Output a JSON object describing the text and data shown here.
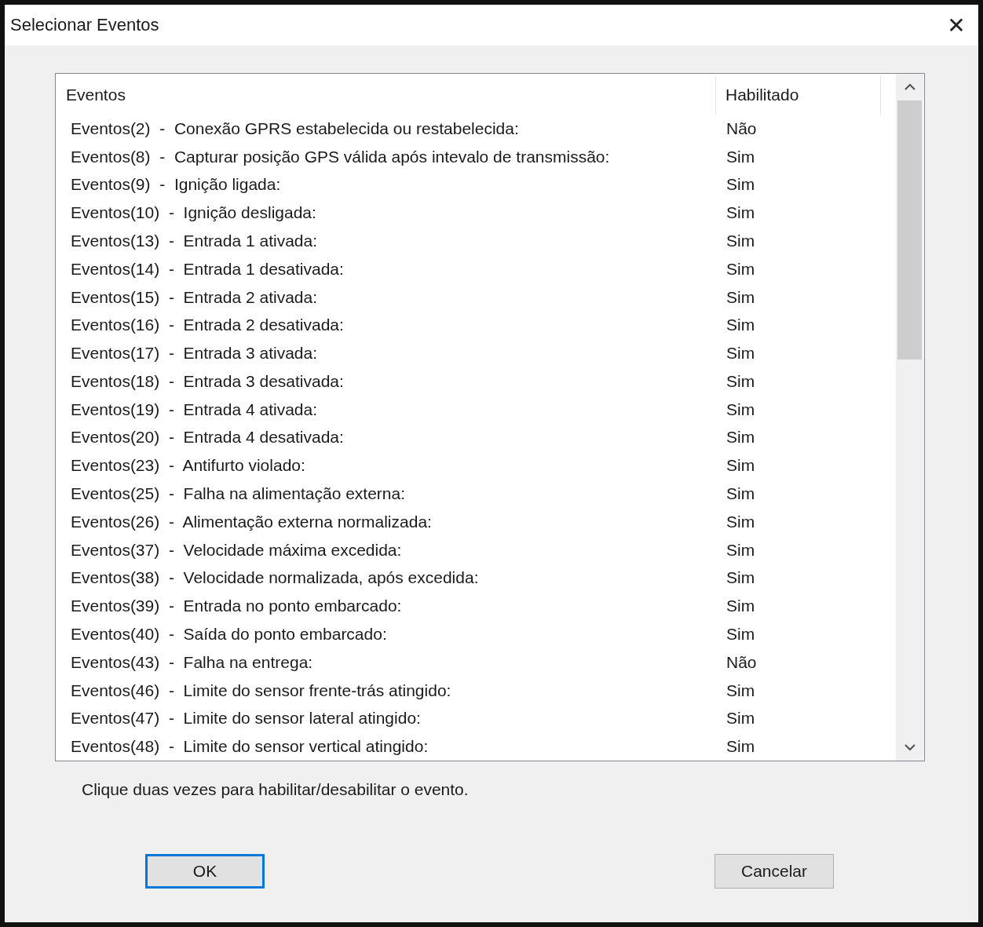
{
  "window": {
    "title": "Selecionar Eventos",
    "close": "✕"
  },
  "table": {
    "columns": [
      "Eventos",
      "Habilitado"
    ],
    "rows": [
      {
        "event": "Eventos(2)  -  Conexão GPRS estabelecida ou restabelecida:",
        "enabled": "Não"
      },
      {
        "event": "Eventos(8)  -  Capturar posição GPS válida após intevalo de transmissão:",
        "enabled": "Sim"
      },
      {
        "event": "Eventos(9)  -  Ignição ligada:",
        "enabled": "Sim"
      },
      {
        "event": "Eventos(10)  -  Ignição desligada:",
        "enabled": "Sim"
      },
      {
        "event": "Eventos(13)  -  Entrada 1 ativada:",
        "enabled": "Sim"
      },
      {
        "event": "Eventos(14)  -  Entrada 1 desativada:",
        "enabled": "Sim"
      },
      {
        "event": "Eventos(15)  -  Entrada 2 ativada:",
        "enabled": "Sim"
      },
      {
        "event": "Eventos(16)  -  Entrada 2 desativada:",
        "enabled": "Sim"
      },
      {
        "event": "Eventos(17)  -  Entrada 3 ativada:",
        "enabled": "Sim"
      },
      {
        "event": "Eventos(18)  -  Entrada 3 desativada:",
        "enabled": "Sim"
      },
      {
        "event": "Eventos(19)  -  Entrada 4 ativada:",
        "enabled": "Sim"
      },
      {
        "event": "Eventos(20)  -  Entrada 4 desativada:",
        "enabled": "Sim"
      },
      {
        "event": "Eventos(23)  -  Antifurto violado:",
        "enabled": "Sim"
      },
      {
        "event": "Eventos(25)  -  Falha na alimentação externa:",
        "enabled": "Sim"
      },
      {
        "event": "Eventos(26)  -  Alimentação externa normalizada:",
        "enabled": "Sim"
      },
      {
        "event": "Eventos(37)  -  Velocidade máxima excedida:",
        "enabled": "Sim"
      },
      {
        "event": "Eventos(38)  -  Velocidade normalizada, após excedida:",
        "enabled": "Sim"
      },
      {
        "event": "Eventos(39)  -  Entrada no ponto embarcado:",
        "enabled": "Sim"
      },
      {
        "event": "Eventos(40)  -  Saída do ponto embarcado:",
        "enabled": "Sim"
      },
      {
        "event": "Eventos(43)  -  Falha na entrega:",
        "enabled": "Não"
      },
      {
        "event": "Eventos(46)  -  Limite do sensor frente-trás atingido:",
        "enabled": "Sim"
      },
      {
        "event": "Eventos(47)  -  Limite do sensor lateral atingido:",
        "enabled": "Sim"
      },
      {
        "event": "Eventos(48)  -  Limite do sensor vertical atingido:",
        "enabled": "Sim"
      }
    ]
  },
  "hint": "Clique duas vezes para habilitar/desabilitar o evento.",
  "buttons": [
    {
      "label": "OK",
      "default": true
    },
    {
      "label": "Cancelar",
      "default": false
    }
  ]
}
